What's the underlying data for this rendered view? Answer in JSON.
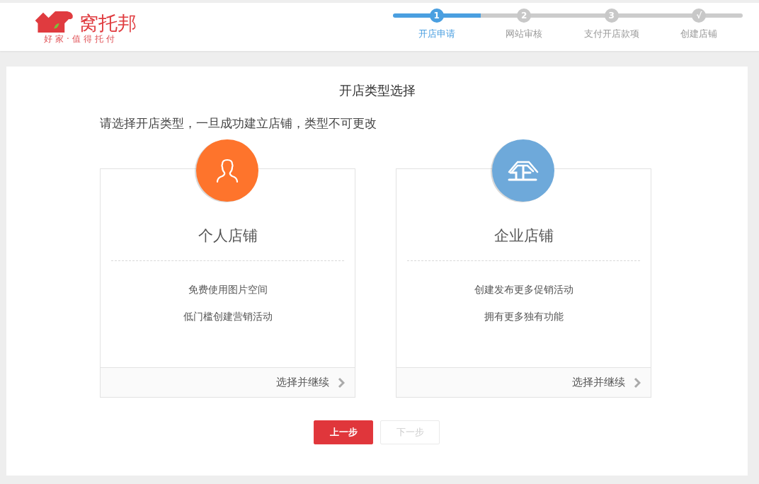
{
  "logo": {
    "name": "窝托邦",
    "slogan": "好家·值得托付"
  },
  "steps": [
    {
      "number": "1",
      "label": "开店申请",
      "selected": true
    },
    {
      "number": "2",
      "label": "网站审核",
      "selected": false
    },
    {
      "number": "3",
      "label": "支付开店款项",
      "selected": false
    },
    {
      "number": "√",
      "label": "创建店铺",
      "selected": false
    }
  ],
  "title": "开店类型选择",
  "notice": "请选择开店类型，一旦成功建立店铺，类型不可更改",
  "shop_types": [
    {
      "kind": "person",
      "color": "#fe742c",
      "name": "个人店铺",
      "features": [
        "免费使用图片空间",
        "低门槛创建营销活动"
      ],
      "action": "选择并继续"
    },
    {
      "kind": "enterprise",
      "color": "#6ea9da",
      "name": "企业店铺",
      "features": [
        "创建发布更多促销活动",
        "拥有更多独有功能"
      ],
      "action": "选择并继续"
    }
  ],
  "buttons": [
    {
      "label": "上一步",
      "disabled": false
    },
    {
      "label": "下一步",
      "disabled": true
    }
  ]
}
